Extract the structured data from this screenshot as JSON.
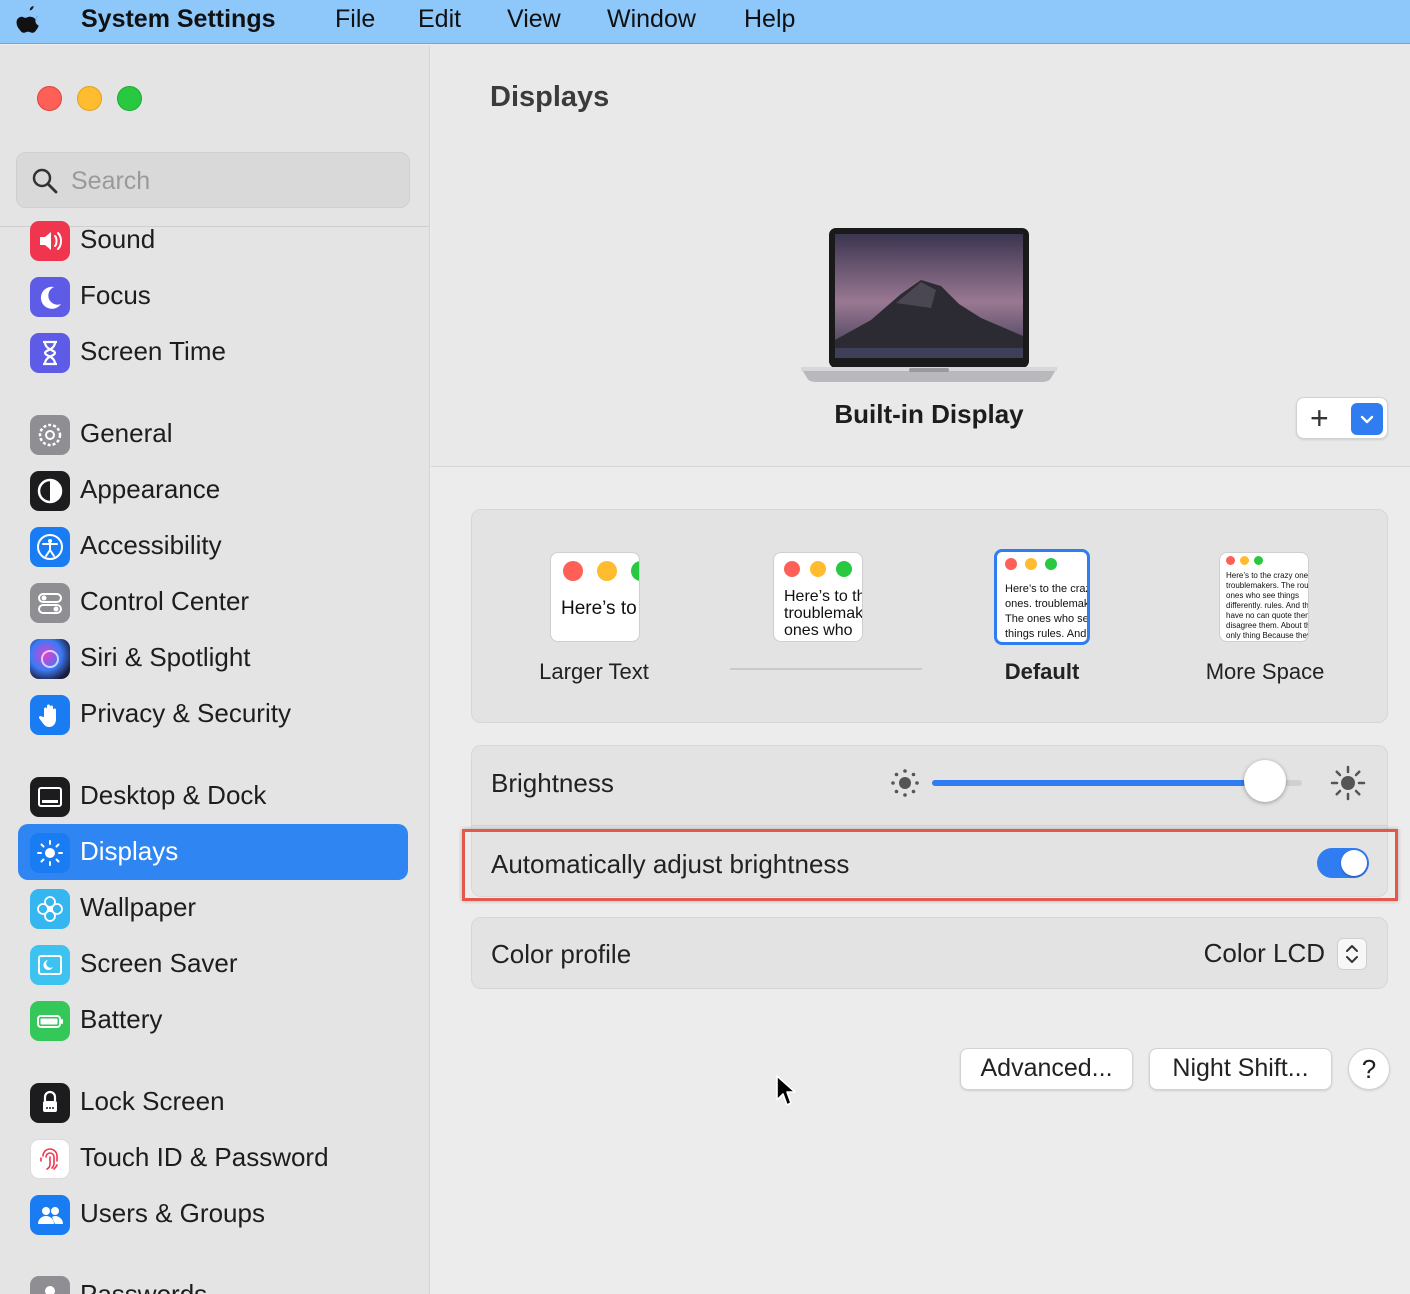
{
  "menubar": {
    "app_name": "System Settings",
    "items": [
      "File",
      "Edit",
      "View",
      "Window",
      "Help"
    ]
  },
  "sidebar": {
    "search_placeholder": "Search",
    "items": [
      {
        "label": "Sound",
        "icon": "speaker-icon",
        "color": "#f0354f"
      },
      {
        "label": "Focus",
        "icon": "moon-icon",
        "color": "#5e5ce6"
      },
      {
        "label": "Screen Time",
        "icon": "hourglass-icon",
        "color": "#5e5ce6"
      },
      {
        "label": "General",
        "icon": "gear-icon",
        "color": "#8e8e93"
      },
      {
        "label": "Appearance",
        "icon": "appearance-icon",
        "color": "#1c1c1e"
      },
      {
        "label": "Accessibility",
        "icon": "accessibility-icon",
        "color": "#1a7cf2"
      },
      {
        "label": "Control Center",
        "icon": "toggles-icon",
        "color": "#8e8e93"
      },
      {
        "label": "Siri & Spotlight",
        "icon": "siri-icon",
        "color": "#2b2b4a"
      },
      {
        "label": "Privacy & Security",
        "icon": "hand-icon",
        "color": "#1a7cf2"
      },
      {
        "label": "Desktop & Dock",
        "icon": "dock-icon",
        "color": "#1c1c1e"
      },
      {
        "label": "Displays",
        "icon": "sun-icon",
        "color": "#1a7cf2",
        "selected": true
      },
      {
        "label": "Wallpaper",
        "icon": "flower-icon",
        "color": "#35b6f0"
      },
      {
        "label": "Screen Saver",
        "icon": "screensaver-icon",
        "color": "#3ec2f0"
      },
      {
        "label": "Battery",
        "icon": "battery-icon",
        "color": "#34c759"
      },
      {
        "label": "Lock Screen",
        "icon": "lock-icon",
        "color": "#1c1c1e"
      },
      {
        "label": "Touch ID & Password",
        "icon": "fingerprint-icon",
        "color": "#ffffff"
      },
      {
        "label": "Users & Groups",
        "icon": "users-icon",
        "color": "#1a7cf2"
      },
      {
        "label": "Passwords",
        "icon": "key-icon",
        "color": "#8e8e93"
      }
    ]
  },
  "main": {
    "title": "Displays",
    "display_name": "Built-in Display",
    "add_button": "+",
    "resolution": {
      "options": [
        {
          "label": "Larger Text",
          "preview": "Here’s to the crazy ones troublemakers"
        },
        {
          "label": "",
          "preview": "Here’s to the troublemakers ones who"
        },
        {
          "label": "Default",
          "preview": "Here’s to the crazy ones. troublemakers. The ones who see things rules. And they have",
          "selected": true
        },
        {
          "label": "More Space",
          "preview": "Here’s to the crazy ones. troublemakers. The round ones who see things differently. rules. And they have no can quote them, disagree them. About the only thing Because they change things"
        }
      ]
    },
    "brightness": {
      "label": "Brightness",
      "value": 0.9
    },
    "auto_brightness": {
      "label": "Automatically adjust brightness",
      "on": true
    },
    "color_profile": {
      "label": "Color profile",
      "value": "Color LCD"
    },
    "buttons": {
      "advanced": "Advanced...",
      "night_shift": "Night Shift...",
      "help": "?"
    }
  }
}
